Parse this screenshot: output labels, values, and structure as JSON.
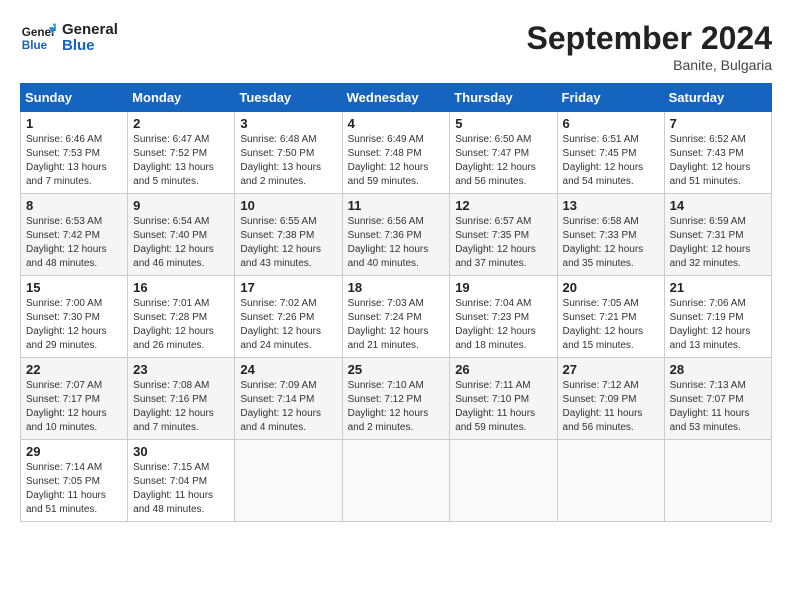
{
  "header": {
    "logo_line1": "General",
    "logo_line2": "Blue",
    "month": "September 2024",
    "location": "Banite, Bulgaria"
  },
  "weekdays": [
    "Sunday",
    "Monday",
    "Tuesday",
    "Wednesday",
    "Thursday",
    "Friday",
    "Saturday"
  ],
  "weeks": [
    [
      {
        "day": "1",
        "info": "Sunrise: 6:46 AM\nSunset: 7:53 PM\nDaylight: 13 hours\nand 7 minutes."
      },
      {
        "day": "2",
        "info": "Sunrise: 6:47 AM\nSunset: 7:52 PM\nDaylight: 13 hours\nand 5 minutes."
      },
      {
        "day": "3",
        "info": "Sunrise: 6:48 AM\nSunset: 7:50 PM\nDaylight: 13 hours\nand 2 minutes."
      },
      {
        "day": "4",
        "info": "Sunrise: 6:49 AM\nSunset: 7:48 PM\nDaylight: 12 hours\nand 59 minutes."
      },
      {
        "day": "5",
        "info": "Sunrise: 6:50 AM\nSunset: 7:47 PM\nDaylight: 12 hours\nand 56 minutes."
      },
      {
        "day": "6",
        "info": "Sunrise: 6:51 AM\nSunset: 7:45 PM\nDaylight: 12 hours\nand 54 minutes."
      },
      {
        "day": "7",
        "info": "Sunrise: 6:52 AM\nSunset: 7:43 PM\nDaylight: 12 hours\nand 51 minutes."
      }
    ],
    [
      {
        "day": "8",
        "info": "Sunrise: 6:53 AM\nSunset: 7:42 PM\nDaylight: 12 hours\nand 48 minutes."
      },
      {
        "day": "9",
        "info": "Sunrise: 6:54 AM\nSunset: 7:40 PM\nDaylight: 12 hours\nand 46 minutes."
      },
      {
        "day": "10",
        "info": "Sunrise: 6:55 AM\nSunset: 7:38 PM\nDaylight: 12 hours\nand 43 minutes."
      },
      {
        "day": "11",
        "info": "Sunrise: 6:56 AM\nSunset: 7:36 PM\nDaylight: 12 hours\nand 40 minutes."
      },
      {
        "day": "12",
        "info": "Sunrise: 6:57 AM\nSunset: 7:35 PM\nDaylight: 12 hours\nand 37 minutes."
      },
      {
        "day": "13",
        "info": "Sunrise: 6:58 AM\nSunset: 7:33 PM\nDaylight: 12 hours\nand 35 minutes."
      },
      {
        "day": "14",
        "info": "Sunrise: 6:59 AM\nSunset: 7:31 PM\nDaylight: 12 hours\nand 32 minutes."
      }
    ],
    [
      {
        "day": "15",
        "info": "Sunrise: 7:00 AM\nSunset: 7:30 PM\nDaylight: 12 hours\nand 29 minutes."
      },
      {
        "day": "16",
        "info": "Sunrise: 7:01 AM\nSunset: 7:28 PM\nDaylight: 12 hours\nand 26 minutes."
      },
      {
        "day": "17",
        "info": "Sunrise: 7:02 AM\nSunset: 7:26 PM\nDaylight: 12 hours\nand 24 minutes."
      },
      {
        "day": "18",
        "info": "Sunrise: 7:03 AM\nSunset: 7:24 PM\nDaylight: 12 hours\nand 21 minutes."
      },
      {
        "day": "19",
        "info": "Sunrise: 7:04 AM\nSunset: 7:23 PM\nDaylight: 12 hours\nand 18 minutes."
      },
      {
        "day": "20",
        "info": "Sunrise: 7:05 AM\nSunset: 7:21 PM\nDaylight: 12 hours\nand 15 minutes."
      },
      {
        "day": "21",
        "info": "Sunrise: 7:06 AM\nSunset: 7:19 PM\nDaylight: 12 hours\nand 13 minutes."
      }
    ],
    [
      {
        "day": "22",
        "info": "Sunrise: 7:07 AM\nSunset: 7:17 PM\nDaylight: 12 hours\nand 10 minutes."
      },
      {
        "day": "23",
        "info": "Sunrise: 7:08 AM\nSunset: 7:16 PM\nDaylight: 12 hours\nand 7 minutes."
      },
      {
        "day": "24",
        "info": "Sunrise: 7:09 AM\nSunset: 7:14 PM\nDaylight: 12 hours\nand 4 minutes."
      },
      {
        "day": "25",
        "info": "Sunrise: 7:10 AM\nSunset: 7:12 PM\nDaylight: 12 hours\nand 2 minutes."
      },
      {
        "day": "26",
        "info": "Sunrise: 7:11 AM\nSunset: 7:10 PM\nDaylight: 11 hours\nand 59 minutes."
      },
      {
        "day": "27",
        "info": "Sunrise: 7:12 AM\nSunset: 7:09 PM\nDaylight: 11 hours\nand 56 minutes."
      },
      {
        "day": "28",
        "info": "Sunrise: 7:13 AM\nSunset: 7:07 PM\nDaylight: 11 hours\nand 53 minutes."
      }
    ],
    [
      {
        "day": "29",
        "info": "Sunrise: 7:14 AM\nSunset: 7:05 PM\nDaylight: 11 hours\nand 51 minutes."
      },
      {
        "day": "30",
        "info": "Sunrise: 7:15 AM\nSunset: 7:04 PM\nDaylight: 11 hours\nand 48 minutes."
      },
      {
        "day": "",
        "info": ""
      },
      {
        "day": "",
        "info": ""
      },
      {
        "day": "",
        "info": ""
      },
      {
        "day": "",
        "info": ""
      },
      {
        "day": "",
        "info": ""
      }
    ]
  ]
}
